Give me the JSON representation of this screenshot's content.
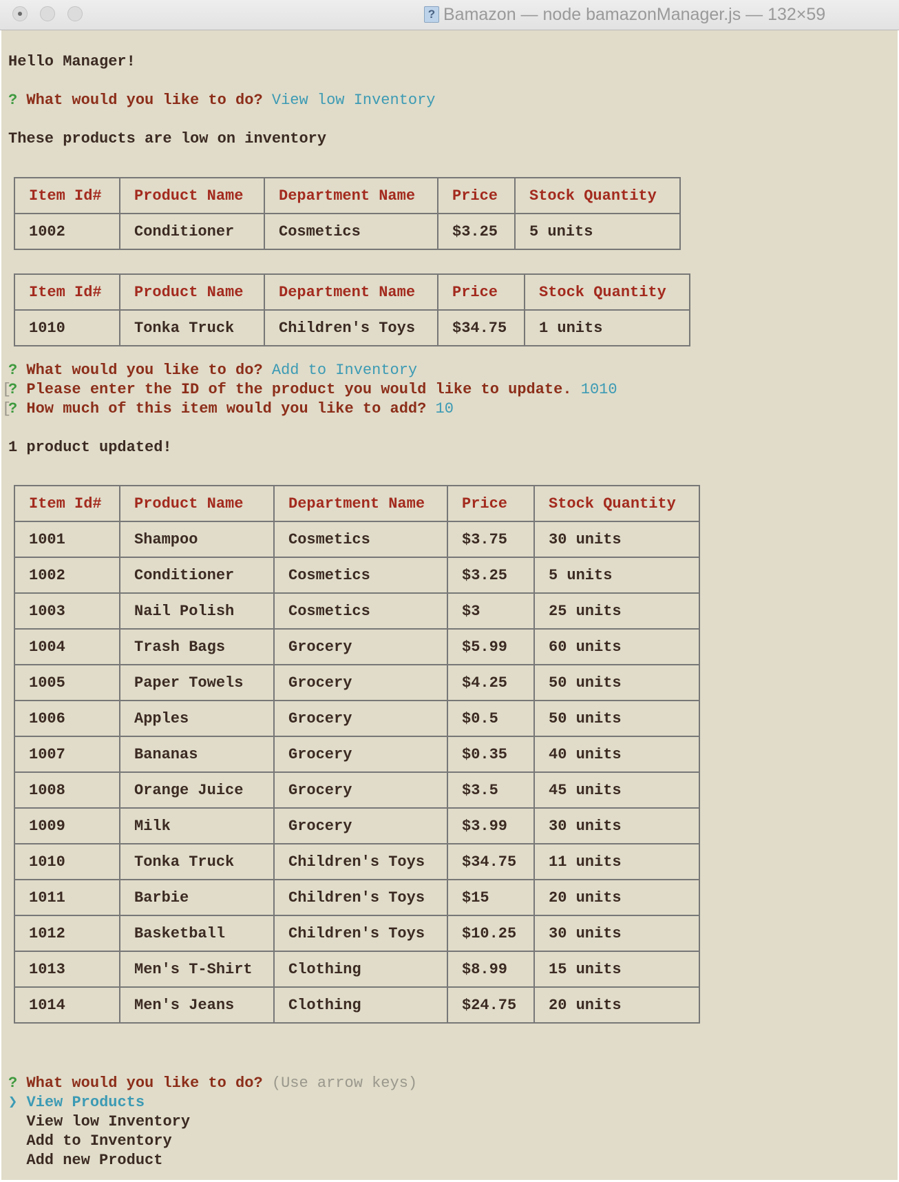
{
  "window": {
    "title": "Bamazon — node bamazonManager.js — 132×59"
  },
  "terminal": {
    "greeting": "Hello Manager!",
    "prompt_mark": "?",
    "prompt_question": "What would you like to do?",
    "answer_1": "View low Inventory",
    "low_inventory_msg": "These products are low on inventory",
    "answer_2": "Add to Inventory",
    "id_question": "Please enter the ID of the product you would like to update.",
    "id_answer": "1010",
    "qty_question": "How much of this item would you like to add?",
    "qty_answer": "10",
    "bracket": "[",
    "updated_msg": "1 product updated!",
    "final_hint": "(Use arrow keys)",
    "menu_pointer": "❯",
    "menu": [
      "View Products",
      "View low Inventory",
      "Add to Inventory",
      "Add new Product"
    ]
  },
  "table_headers": [
    "Item Id#",
    "Product Name",
    "Department Name",
    "Price",
    "Stock Quantity"
  ],
  "low_inventory_tables": [
    {
      "rows": [
        [
          "1002",
          "Conditioner",
          "Cosmetics",
          "$3.25",
          "5 units"
        ]
      ]
    },
    {
      "rows": [
        [
          "1010",
          "Tonka Truck",
          "Children's Toys",
          "$34.75",
          "1 units"
        ]
      ]
    }
  ],
  "products_table": {
    "rows": [
      [
        "1001",
        "Shampoo",
        "Cosmetics",
        "$3.75",
        "30 units"
      ],
      [
        "1002",
        "Conditioner",
        "Cosmetics",
        "$3.25",
        "5 units"
      ],
      [
        "1003",
        "Nail Polish",
        "Cosmetics",
        "$3",
        "25 units"
      ],
      [
        "1004",
        "Trash Bags",
        "Grocery",
        "$5.99",
        "60 units"
      ],
      [
        "1005",
        "Paper Towels",
        "Grocery",
        "$4.25",
        "50 units"
      ],
      [
        "1006",
        "Apples",
        "Grocery",
        "$0.5",
        "50 units"
      ],
      [
        "1007",
        "Bananas",
        "Grocery",
        "$0.35",
        "40 units"
      ],
      [
        "1008",
        "Orange Juice",
        "Grocery",
        "$3.5",
        "45 units"
      ],
      [
        "1009",
        "Milk",
        "Grocery",
        "$3.99",
        "30 units"
      ],
      [
        "1010",
        "Tonka Truck",
        "Children's Toys",
        "$34.75",
        "11 units"
      ],
      [
        "1011",
        "Barbie",
        "Children's Toys",
        "$15",
        "20 units"
      ],
      [
        "1012",
        "Basketball",
        "Children's Toys",
        "$10.25",
        "30 units"
      ],
      [
        "1013",
        "Men's T-Shirt",
        "Clothing",
        "$8.99",
        "15 units"
      ],
      [
        "1014",
        "Men's Jeans",
        "Clothing",
        "$24.75",
        "20 units"
      ]
    ]
  },
  "colors": {
    "terminal_bg": "#e0dcc9",
    "prompt": "#8c2e1a",
    "answer": "#3c9ab4",
    "question_mark": "#3f9a3f",
    "header_text": "#a32a1e",
    "text": "#3b2a22"
  }
}
